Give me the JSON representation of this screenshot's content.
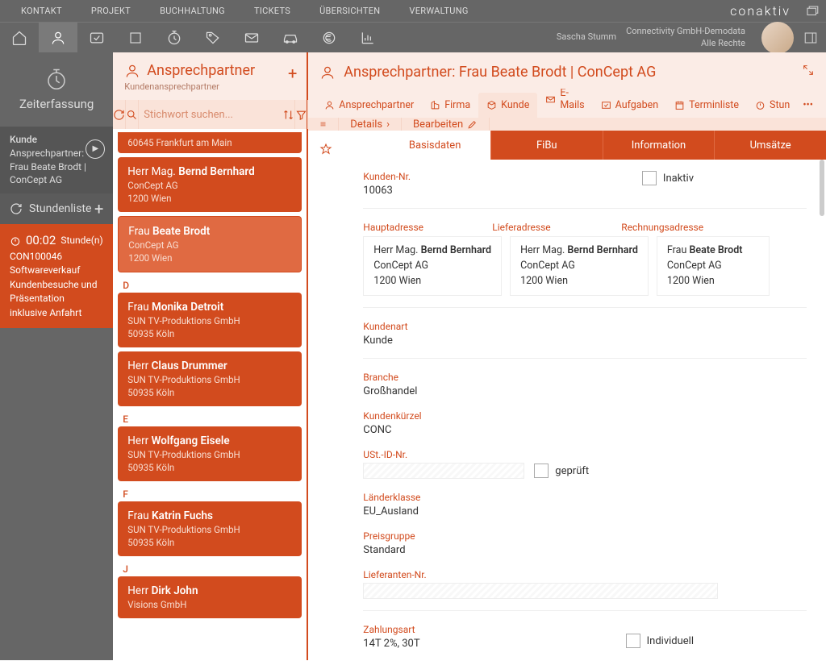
{
  "topnav": [
    "KONTAKT",
    "PROJEKT",
    "BUCHHALTUNG",
    "TICKETS",
    "ÜBERSICHTEN",
    "VERWALTUNG"
  ],
  "brand": "conaktiv",
  "user": {
    "name": "Sascha Stumm",
    "org": "Connectivity GmbH-Demodata",
    "role": "Alle Rechte"
  },
  "left": {
    "title": "Zeiterfassung",
    "currentTask": {
      "line1": "Kunde",
      "line2": "Ansprechpartner: Frau Beate Brodt | ConCept AG"
    },
    "listen": {
      "title": "Stundenliste"
    },
    "timer": {
      "time": "00:02",
      "unit": "Stunde(n)",
      "code": "CON100046",
      "line1": "Softwareverkauf",
      "line2": "Kundenbesuche und Präsentation inklusive Anfahrt"
    }
  },
  "mid": {
    "title": "Ansprechpartner",
    "subtitle": "Kundenansprechpartner",
    "searchPlaceholder": "Stichwort suchen...",
    "overflow": "60645 Frankfurt am Main",
    "contacts": [
      {
        "pre": "Herr Mag.",
        "last": "Bernd Bernhard",
        "company": "ConCept AG",
        "city": "1200 Wien",
        "selected": false
      },
      {
        "pre": "Frau",
        "last": "Beate Brodt",
        "company": "ConCept AG",
        "city": "1200 Wien",
        "selected": true
      }
    ],
    "groupD": "D",
    "groupDitems": [
      {
        "pre": "Frau",
        "last": "Monika Detroit",
        "company": "SUN TV-Produktions GmbH",
        "city": "50935 Köln"
      },
      {
        "pre": "Herr",
        "last": "Claus Drummer",
        "company": "SUN TV-Produktions GmbH",
        "city": "50935 Köln"
      }
    ],
    "groupE": "E",
    "groupEitems": [
      {
        "pre": "Herr",
        "last": "Wolfgang Eisele",
        "company": "SUN TV-Produktions GmbH",
        "city": "50935 Köln"
      }
    ],
    "groupF": "F",
    "groupFitems": [
      {
        "pre": "Frau",
        "last": "Katrin Fuchs",
        "company": "SUN TV-Produktions GmbH",
        "city": "50935 Köln"
      }
    ],
    "groupJ": "J",
    "groupJitems": [
      {
        "pre": "Herr",
        "last": "Dirk John",
        "company": "Visions GmbH",
        "city": ""
      }
    ]
  },
  "right": {
    "title": "Ansprechpartner: Frau Beate Brodt | ConCept AG",
    "tabs": [
      "Ansprechpartner",
      "Firma",
      "Kunde",
      "E-Mails",
      "Aufgaben",
      "Terminliste",
      "Stun"
    ],
    "activeTab": "Kunde",
    "subbar": {
      "details": "Details",
      "edit": "Bearbeiten"
    },
    "dataTabs": [
      "Basisdaten",
      "FiBu",
      "Information",
      "Umsätze"
    ],
    "activeDataTab": "Basisdaten",
    "fields": {
      "kundennr": {
        "label": "Kunden-Nr.",
        "value": "10063"
      },
      "inaktiv": "Inaktiv",
      "haupt": {
        "label": "Hauptadresse",
        "pre": "Herr Mag.",
        "last": "Bernd Bernhard",
        "company": "ConCept AG",
        "city": "1200 Wien"
      },
      "liefer": {
        "label": "Lieferadresse",
        "pre": "Herr Mag.",
        "last": "Bernd Bernhard",
        "company": "ConCept AG",
        "city": "1200 Wien"
      },
      "rech": {
        "label": "Rechnungsadresse",
        "pre": "Frau",
        "last": "Beate Brodt",
        "company": "ConCept AG",
        "city": "1200 Wien"
      },
      "kundenart": {
        "label": "Kundenart",
        "value": "Kunde"
      },
      "branche": {
        "label": "Branche",
        "value": "Großhandel"
      },
      "kurzel": {
        "label": "Kundenkürzel",
        "value": "CONC"
      },
      "ustid": {
        "label": "USt.-ID-Nr.",
        "check": "geprüft"
      },
      "lander": {
        "label": "Länderklasse",
        "value": "EU_Ausland"
      },
      "preis": {
        "label": "Preisgruppe",
        "value": "Standard"
      },
      "liefnr": {
        "label": "Lieferanten-Nr."
      },
      "zahl": {
        "label": "Zahlungsart",
        "value": "14T 2%, 30T",
        "check": "Individuell"
      }
    }
  }
}
